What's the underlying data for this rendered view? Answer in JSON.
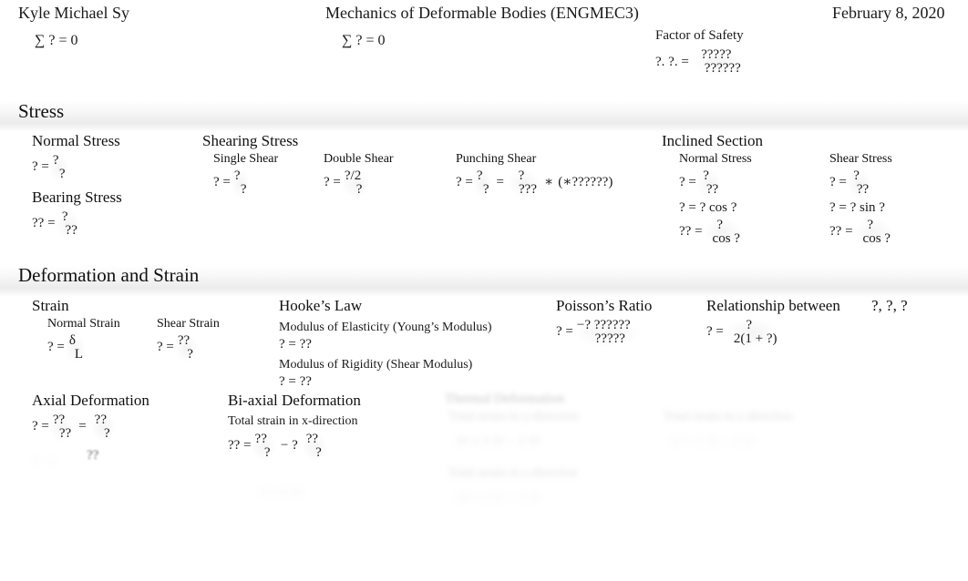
{
  "header": {
    "name": "Kyle Michael Sy",
    "course": "Mechanics of Deformable Bodies (ENGMEC3)",
    "date": "February 8, 2020"
  },
  "equilibrium": {
    "sum_1": "∑ ? = 0",
    "sum_2": "∑ ? = 0"
  },
  "factor_of_safety": {
    "title": "Factor of Safety",
    "lhs": "?. ?. =",
    "numerator": "?????",
    "denominator": "??????"
  },
  "sections": [
    {
      "id": "stress",
      "title": "Stress",
      "groups": [
        {
          "id": "normal-stress",
          "title": "Normal Stress",
          "equations": [
            {
              "lhs": "? =",
              "num": "?",
              "den": "?"
            }
          ]
        },
        {
          "id": "bearing-stress",
          "title": "Bearing Stress",
          "equations": [
            {
              "lhs": "?? =",
              "num": "?",
              "den": "??"
            }
          ]
        },
        {
          "id": "shearing-stress",
          "title": "Shearing Stress",
          "subgroups": [
            {
              "id": "single-shear",
              "title": "Single Shear",
              "lhs": "? =",
              "num": "?",
              "den": "?"
            },
            {
              "id": "double-shear",
              "title": "Double Shear",
              "lhs": "? =",
              "num": "?/2",
              "den": "?"
            },
            {
              "id": "punching-shear",
              "title": "Punching Shear",
              "lhs": "? =",
              "num": "?",
              "den": "?",
              "mid_op": "=",
              "num2": "?",
              "den2": "???",
              "tail_op": "∗",
              "tail": "(∗??????)"
            }
          ]
        },
        {
          "id": "inclined-section",
          "title": "Inclined Section",
          "subgroups": [
            {
              "id": "inclined-normal-stress",
              "title": "Normal Stress",
              "lines": [
                {
                  "type": "frac",
                  "lhs": "? =",
                  "num": "?",
                  "den": "??"
                },
                {
                  "type": "plain",
                  "text": "? = ? cos ?"
                },
                {
                  "type": "frac",
                  "lhs": "?? =",
                  "num": "?",
                  "den": "cos ?"
                }
              ]
            },
            {
              "id": "inclined-shear-stress",
              "title": "Shear Stress",
              "lines": [
                {
                  "type": "frac",
                  "lhs": "? =",
                  "num": "?",
                  "den": "??"
                },
                {
                  "type": "plain",
                  "text": "? = ? sin ?"
                },
                {
                  "type": "frac",
                  "lhs": "?? =",
                  "num": "?",
                  "den": "cos ?"
                }
              ]
            }
          ]
        }
      ]
    },
    {
      "id": "deformation-and-strain",
      "title": "Deformation and Strain",
      "groups": [
        {
          "id": "strain",
          "title": "Strain",
          "subgroups": [
            {
              "id": "normal-strain",
              "title": "Normal Strain",
              "lhs": "? =",
              "num": "δ",
              "den": "L"
            },
            {
              "id": "shear-strain",
              "title": "Shear Strain",
              "lhs": "? =",
              "num": "??",
              "den": "?"
            }
          ]
        },
        {
          "id": "hookes-law",
          "title": "Hooke’s Law",
          "lines": [
            "Modulus of Elasticity (Young’s Modulus)",
            "? = ??",
            "Modulus of Rigidity (Shear Modulus)",
            "? = ??"
          ]
        },
        {
          "id": "poissons-ratio",
          "title": "Poisson’s Ratio",
          "equations": [
            {
              "lhs": "? =",
              "num": "−? ??????",
              "den": "?????"
            }
          ]
        },
        {
          "id": "relationship-between",
          "title": "Relationship between",
          "title_suffix": "?, ?, ?",
          "equations": [
            {
              "lhs": "? =",
              "num": "?",
              "den": "2(1 + ?)"
            }
          ]
        },
        {
          "id": "axial-deformation",
          "title": "Axial Deformation",
          "equations": [
            {
              "lhs": "? =",
              "num": "??",
              "den": "??",
              "mid_op": "=",
              "num2": "??",
              "den2": "?"
            }
          ],
          "cut_line": "??"
        },
        {
          "id": "biaxial-deformation",
          "title": "Bi-axial Deformation",
          "subtitle": "Total strain in x-direction",
          "equations": [
            {
              "lhs": "?? =",
              "num": "??",
              "den": "?",
              "mid_op": "− ?",
              "num2": "??",
              "den2": "?"
            }
          ]
        }
      ]
    }
  ],
  "faded": {
    "block_a_title_1": "Thermal Deformation",
    "block_a_title_2": "Total strain in y-direction",
    "block_a_eq": "?? = ? ?? − ? ??",
    "block_a_title_3": "Total strain in z-direction",
    "block_a_eq_2": "?? = ? ?? − ? ??",
    "block_b_title": "Total strain in z-direction",
    "block_b_eq": "?? = ? ?? − ? ??",
    "block_c_eq": "? = ? ??"
  }
}
